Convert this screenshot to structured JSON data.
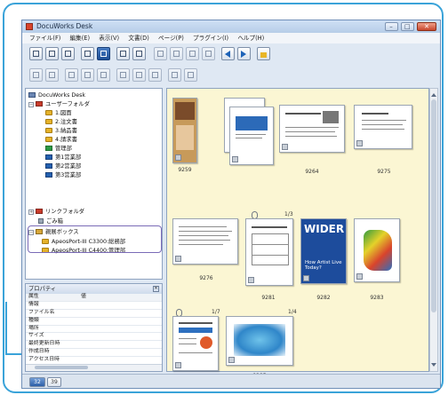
{
  "window": {
    "title": "DocuWorks Desk"
  },
  "menu": [
    "ファイル(F)",
    "編集(E)",
    "表示(V)",
    "文書(D)",
    "ページ(P)",
    "プラグイン(I)",
    "ヘルプ(H)"
  ],
  "tree": {
    "root": "DocuWorks Desk",
    "user_folder": "ユーザーフォルダ",
    "user_children": [
      "1.図面",
      "2.注文書",
      "3.納品書",
      "4.請求書",
      "管理部",
      "第1営業部",
      "第2営業部",
      "第3営業部"
    ],
    "link_folder": "リンクフォルダ",
    "trash": "ごみ箱",
    "mailbox": "親展ボックス",
    "mailbox_children": [
      "ApeosPort-III C3300:総務部",
      "ApeosPort-III C4400:管理部"
    ]
  },
  "properties": {
    "title": "プロパティ",
    "col_attr": "属性",
    "col_value": "値",
    "rows": [
      "情報",
      "ファイル名",
      "種類",
      "場所",
      "サイズ",
      "最終更新日時",
      "作成日時",
      "アクセス日時"
    ]
  },
  "documents": {
    "d9259": "9259",
    "d9264": "9264",
    "d9275": "9275",
    "d9276": "9276",
    "d9281": "9281",
    "d9282": "9282",
    "d9283": "9283",
    "d9285": "9285",
    "count_13": "1/3",
    "count_17": "1/7",
    "count_14": "1/4",
    "magazine_title": "WIDER",
    "magazine_sub": "How Artist Live Today?"
  },
  "status": {
    "btn1": "32",
    "btn2": "39"
  },
  "colors": {
    "accent": "#3aa3d9",
    "workspace": "#fbf6d3",
    "highlight": "#7a6bb7"
  }
}
